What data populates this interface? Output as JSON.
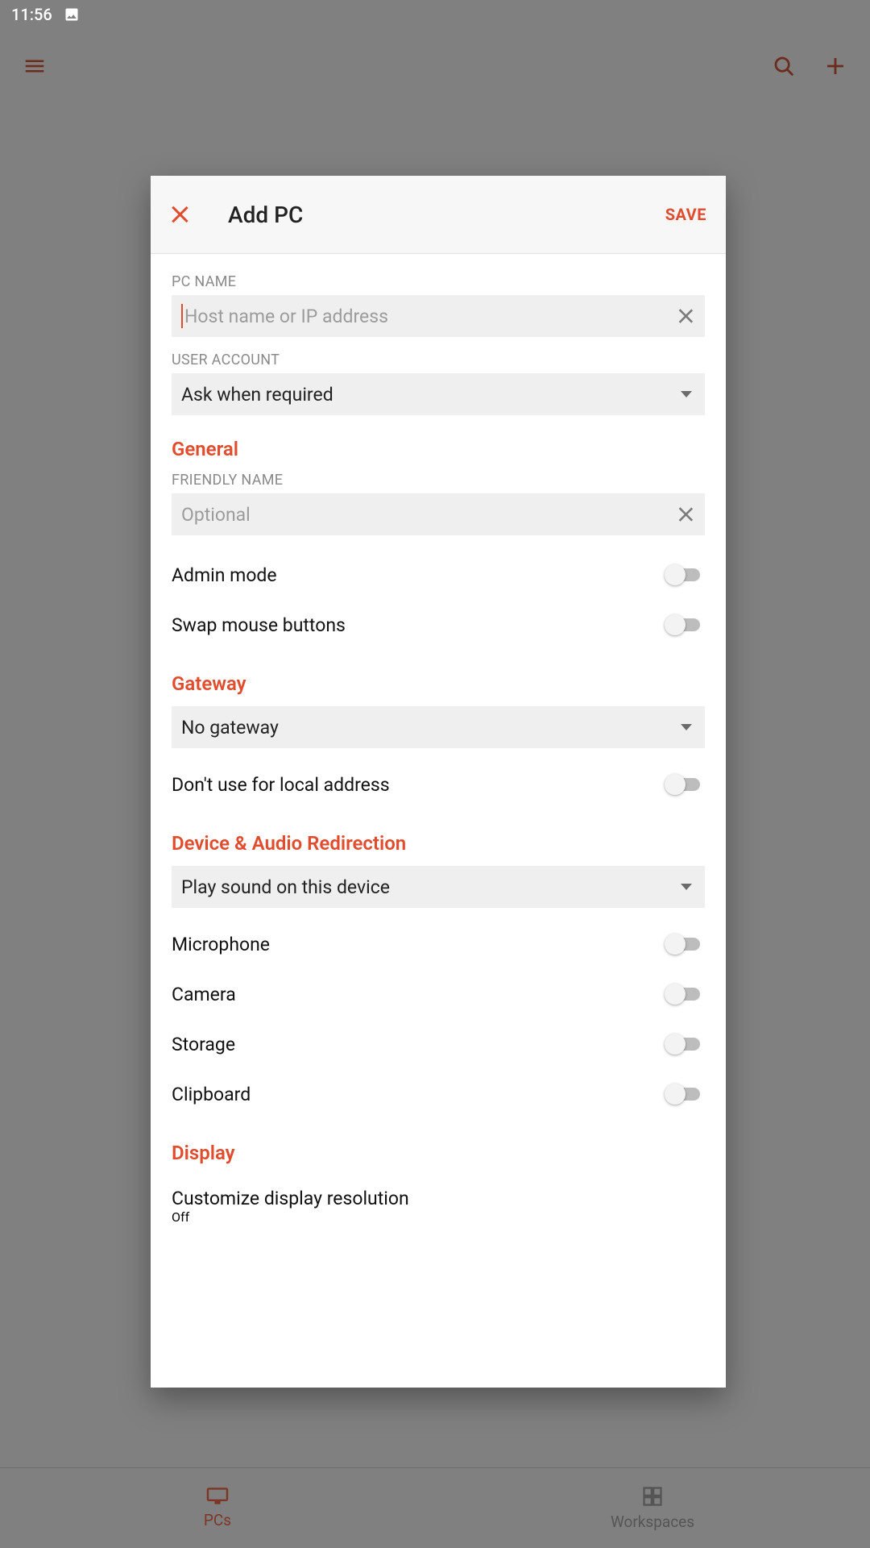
{
  "status": {
    "time": "11:56"
  },
  "nav": {
    "pcs": "PCs",
    "workspaces": "Workspaces"
  },
  "dialog": {
    "title": "Add PC",
    "save": "SAVE",
    "labels": {
      "pc_name": "PC NAME",
      "user_account": "USER ACCOUNT",
      "friendly_name": "FRIENDLY NAME"
    },
    "placeholders": {
      "pc_name": "Host name or IP address",
      "friendly_name": "Optional"
    },
    "values": {
      "user_account": "Ask when required",
      "gateway": "No gateway",
      "audio": "Play sound on this device",
      "display_resolution_state": "Off"
    },
    "sections": {
      "general": "General",
      "gateway": "Gateway",
      "device_audio": "Device & Audio Redirection",
      "display": "Display"
    },
    "rows": {
      "admin_mode": "Admin mode",
      "swap_mouse": "Swap mouse buttons",
      "no_local_gateway": "Don't use for local address",
      "microphone": "Microphone",
      "camera": "Camera",
      "storage": "Storage",
      "clipboard": "Clipboard",
      "custom_display": "Customize display resolution"
    }
  }
}
